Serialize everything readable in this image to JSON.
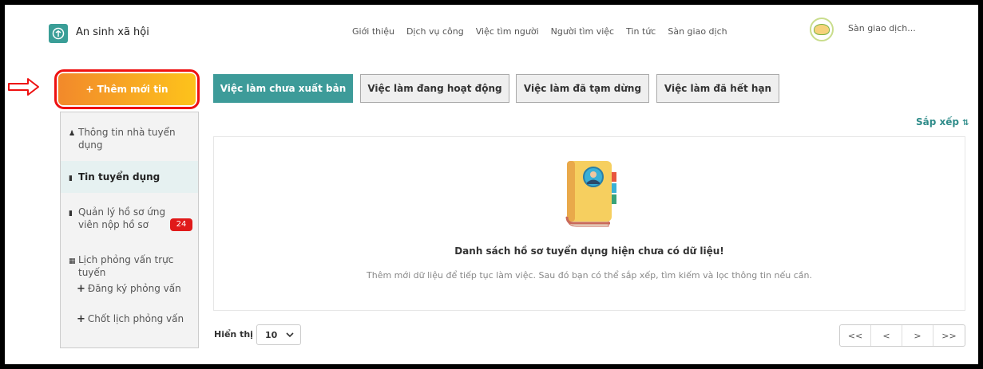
{
  "header": {
    "app_title": "An sinh xã hội",
    "nav": [
      "Giới thiệu",
      "Dịch vụ công",
      "Việc tìm người",
      "Người tìm việc",
      "Tin tức",
      "Sàn giao dịch"
    ],
    "partner_name": "Sàn giao dịch..."
  },
  "actions": {
    "add_new": "+ Thêm mới tin"
  },
  "sidebar": {
    "items": [
      {
        "icon": "user-icon",
        "label": "Thông tin nhà tuyển dụng"
      },
      {
        "icon": "document-icon",
        "label": "Tin tuyển dụng",
        "active": true
      },
      {
        "icon": "document-icon",
        "label": "Quản lý hồ sơ ứng viên nộp hồ sơ",
        "badge": "24"
      },
      {
        "icon": "calendar-icon",
        "label": "Lịch phỏng vấn trực tuyến"
      }
    ],
    "sub_items": [
      "Đăng ký phỏng vấn",
      "Chốt lịch phỏng vấn"
    ]
  },
  "tabs": [
    {
      "label": "Việc làm chưa xuất bản",
      "active": true
    },
    {
      "label": "Việc làm đang hoạt động"
    },
    {
      "label": "Việc làm đã tạm dừng"
    },
    {
      "label": "Việc làm đã hết hạn"
    }
  ],
  "sort_label": "Sắp xếp",
  "empty_state": {
    "title": "Danh sách hồ sơ tuyển dụng hiện chưa có dữ liệu!",
    "subtitle": "Thêm mới dữ liệu để tiếp tục làm việc. Sau đó bạn có thể sắp xếp, tìm kiếm và lọc thông tin nếu cần."
  },
  "footer": {
    "show_label": "Hiển thị",
    "page_size": "10",
    "pager": [
      "<<",
      "<",
      ">",
      ">>"
    ]
  },
  "colors": {
    "accent": "#3d9b99",
    "add_button_start": "#f2892b",
    "add_button_end": "#fdc31b",
    "badge": "#e01a1a",
    "highlight": "#ee1111"
  }
}
